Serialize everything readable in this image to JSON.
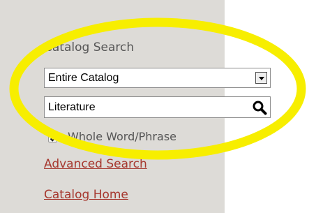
{
  "catalog_search": {
    "heading": "Catalog Search",
    "scope_select": {
      "selected": "Entire Catalog",
      "icon": "chevron-down-icon"
    },
    "query": {
      "value": "Literature",
      "icon": "search-icon"
    },
    "whole_word": {
      "checked": true,
      "label": "Whole Word/Phrase"
    },
    "links": {
      "advanced": "Advanced Search",
      "home": "Catalog Home"
    }
  },
  "colors": {
    "panel_background": "#dddbd7",
    "text": "#555555",
    "link": "#a6382f",
    "highlight_ellipse": "#f7ee00"
  }
}
